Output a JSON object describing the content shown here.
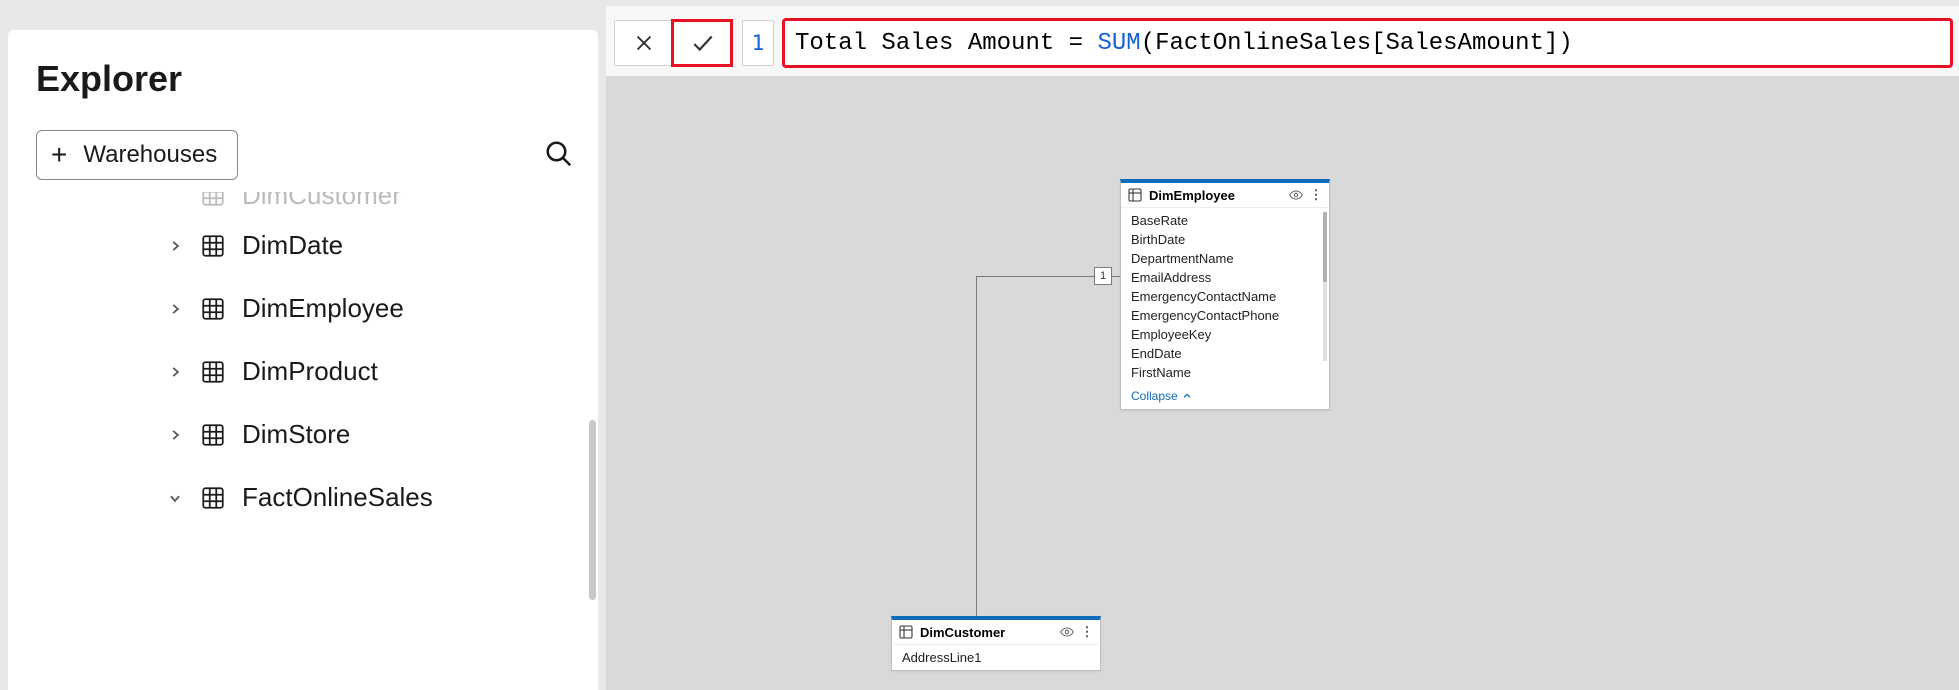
{
  "explorer": {
    "title": "Explorer",
    "warehouses_button": "Warehouses",
    "tree": [
      {
        "label": "DimCustomer",
        "expanded": false,
        "truncated": true
      },
      {
        "label": "DimDate",
        "expanded": false
      },
      {
        "label": "DimEmployee",
        "expanded": false
      },
      {
        "label": "DimProduct",
        "expanded": false
      },
      {
        "label": "DimStore",
        "expanded": false
      },
      {
        "label": "FactOnlineSales",
        "expanded": true
      }
    ]
  },
  "formula_bar": {
    "line_number": "1",
    "tokens": {
      "measure": "Total Sales Amount ",
      "equals": "= ",
      "func": "SUM",
      "open": "(",
      "ref": "FactOnlineSales[SalesAmount]",
      "close": ")"
    }
  },
  "model": {
    "relationship_cardinality": "1",
    "entities": {
      "dim_employee": {
        "title": "DimEmployee",
        "fields": [
          "BaseRate",
          "BirthDate",
          "DepartmentName",
          "EmailAddress",
          "EmergencyContactName",
          "EmergencyContactPhone",
          "EmployeeKey",
          "EndDate",
          "FirstName"
        ],
        "footer": "Collapse"
      },
      "dim_customer": {
        "title": "DimCustomer",
        "fields": [
          "AddressLine1"
        ],
        "footer": ""
      }
    }
  }
}
